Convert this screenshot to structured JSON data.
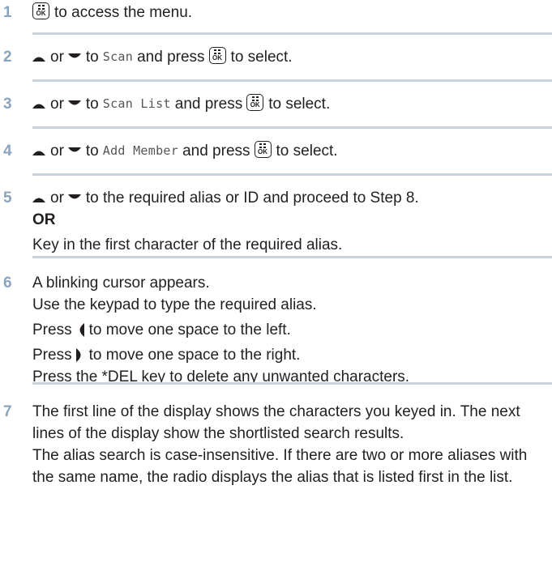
{
  "steps": [
    {
      "num": "1",
      "lines": [
        {
          "segments": [
            {
              "t": "icon",
              "icon": "menu-ok-key-icon"
            },
            {
              "t": "text",
              "v": "to access the menu."
            }
          ]
        }
      ]
    },
    {
      "num": "2",
      "lines": [
        {
          "segments": [
            {
              "t": "icon",
              "icon": "up-arrow-key-icon"
            },
            {
              "t": "text",
              "v": "or"
            },
            {
              "t": "icon",
              "icon": "down-arrow-key-icon"
            },
            {
              "t": "text",
              "v": "to"
            },
            {
              "t": "mono",
              "v": "Scan"
            },
            {
              "t": "text",
              "v": "and press"
            },
            {
              "t": "icon",
              "icon": "menu-ok-key-icon"
            },
            {
              "t": "text",
              "v": "to select."
            }
          ]
        }
      ]
    },
    {
      "num": "3",
      "lines": [
        {
          "segments": [
            {
              "t": "icon",
              "icon": "up-arrow-key-icon"
            },
            {
              "t": "text",
              "v": "or"
            },
            {
              "t": "icon",
              "icon": "down-arrow-key-icon"
            },
            {
              "t": "text",
              "v": "to"
            },
            {
              "t": "mono",
              "v": "Scan List"
            },
            {
              "t": "text",
              "v": "and press"
            },
            {
              "t": "icon",
              "icon": "menu-ok-key-icon"
            },
            {
              "t": "text",
              "v": "to select."
            }
          ]
        }
      ]
    },
    {
      "num": "4",
      "lines": [
        {
          "segments": [
            {
              "t": "icon",
              "icon": "up-arrow-key-icon"
            },
            {
              "t": "text",
              "v": "or"
            },
            {
              "t": "icon",
              "icon": "down-arrow-key-icon"
            },
            {
              "t": "text",
              "v": "to"
            },
            {
              "t": "mono",
              "v": "Add Member"
            },
            {
              "t": "text",
              "v": "and press"
            },
            {
              "t": "icon",
              "icon": "menu-ok-key-icon"
            },
            {
              "t": "text",
              "v": "to select."
            }
          ]
        }
      ]
    },
    {
      "num": "5",
      "lines": [
        {
          "segments": [
            {
              "t": "icon",
              "icon": "up-arrow-key-icon"
            },
            {
              "t": "text",
              "v": "or"
            },
            {
              "t": "icon",
              "icon": "down-arrow-key-icon"
            },
            {
              "t": "text",
              "v": "to the required alias or ID and proceed to Step 8."
            }
          ]
        },
        {
          "segments": [
            {
              "t": "bold",
              "v": "OR"
            }
          ]
        },
        {
          "segments": [
            {
              "t": "text",
              "v": "Key in the first character of the required alias."
            }
          ]
        }
      ]
    },
    {
      "num": "6",
      "lines": [
        {
          "segments": [
            {
              "t": "text",
              "v": "A blinking cursor appears."
            }
          ]
        },
        {
          "segments": [
            {
              "t": "text",
              "v": "Use the keypad to type the required alias."
            }
          ]
        },
        {
          "segments": [
            {
              "t": "text",
              "v": "Press"
            },
            {
              "t": "icon",
              "icon": "left-arrow-key-icon"
            },
            {
              "t": "text",
              "v": "to move one space to the left."
            }
          ]
        },
        {
          "segments": [
            {
              "t": "text",
              "v": "Press"
            },
            {
              "t": "icon",
              "icon": "right-arrow-key-icon"
            },
            {
              "t": "text",
              "v": "to move one space to the right."
            }
          ]
        },
        {
          "segments": [
            {
              "t": "text",
              "v": "Press the *DEL key to delete any unwanted characters."
            }
          ]
        }
      ]
    },
    {
      "num": "7",
      "paragraphs": [
        "The first line of the display shows the characters you keyed in. The next lines of the display show the shortlisted search results.",
        "The alias search is case-insensitive. If there are two or more aliases with the same name, the radio displays the alias that is listed first in the list."
      ]
    }
  ]
}
